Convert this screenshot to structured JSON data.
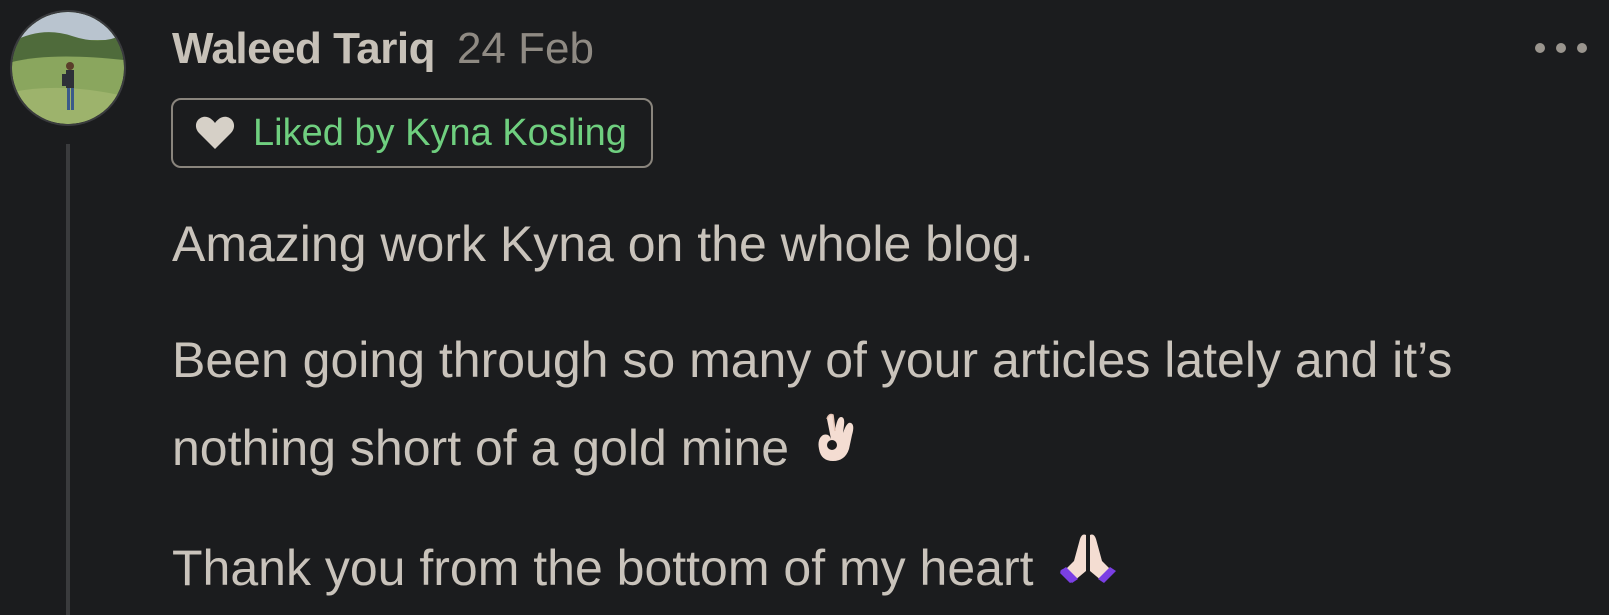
{
  "comment": {
    "author": "Waleed Tariq",
    "date": "24 Feb",
    "liked_by": "Liked by Kyna Kosling",
    "paragraphs": [
      "Amazing work Kyna on the whole blog.",
      "Been going through so many of your articles lately and it’s nothing short of a gold mine",
      "Thank you from the bottom of my heart"
    ]
  },
  "icons": {
    "avatar": "avatar-photo",
    "more": "more-horizontal-icon",
    "heart": "heart-icon",
    "ok_hand": "ok-hand-emoji",
    "praying_hands": "praying-hands-emoji"
  },
  "colors": {
    "background": "#1b1c1e",
    "text": "#c9c3bb",
    "date": "#8f8a83",
    "liked": "#6fcf7f",
    "badge_border": "#8a857d"
  }
}
